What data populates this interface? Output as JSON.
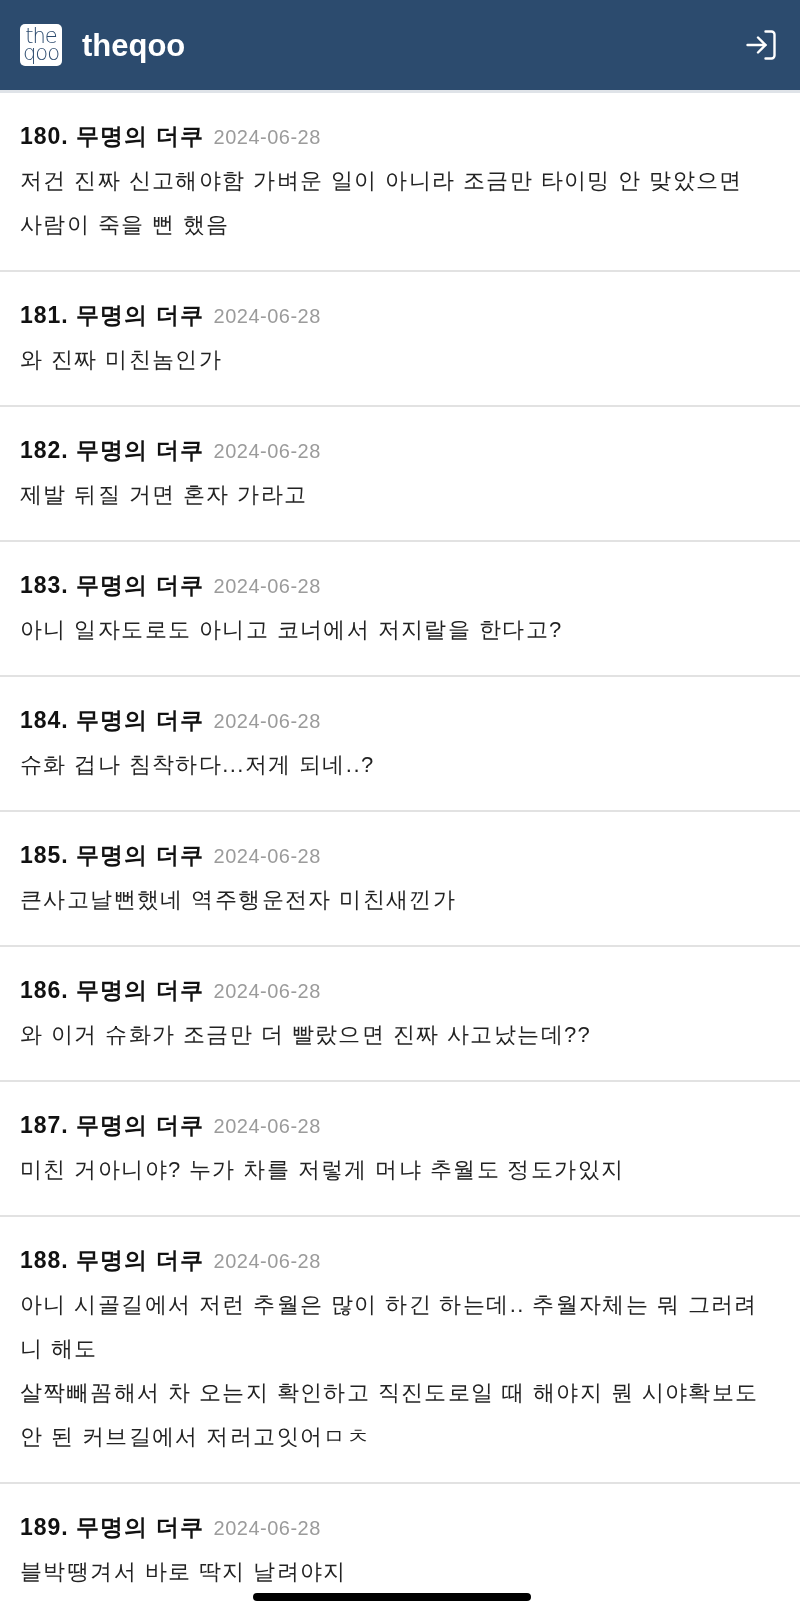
{
  "header": {
    "logo": {
      "lines": [
        "the",
        "qoo"
      ]
    },
    "title": "theqoo"
  },
  "comments": [
    {
      "title": "180. 무명의 더쿠",
      "date": "2024-06-28",
      "body": "저건 진짜 신고해야함 가벼운 일이 아니라 조금만 타이밍 안 맞았으면 사람이 죽을 뻔 했음"
    },
    {
      "title": "181. 무명의 더쿠",
      "date": "2024-06-28",
      "body": "와 진짜 미친놈인가"
    },
    {
      "title": "182. 무명의 더쿠",
      "date": "2024-06-28",
      "body": "제발 뒤질 거면 혼자 가라고"
    },
    {
      "title": "183. 무명의 더쿠",
      "date": "2024-06-28",
      "body": "아니 일자도로도 아니고 코너에서 저지랄을 한다고?"
    },
    {
      "title": "184. 무명의 더쿠",
      "date": "2024-06-28",
      "body": "슈화 겁나 침착하다...저게 되네..?"
    },
    {
      "title": "185. 무명의 더쿠",
      "date": "2024-06-28",
      "body": "큰사고날뻔했네 역주행운전자 미친새낀가"
    },
    {
      "title": "186. 무명의 더쿠",
      "date": "2024-06-28",
      "body": "와 이거 슈화가 조금만 더 빨랐으면 진짜 사고났는데??"
    },
    {
      "title": "187. 무명의 더쿠",
      "date": "2024-06-28",
      "body": "미친 거아니야? 누가 차를 저렇게 머냐 추월도 정도가있지"
    },
    {
      "title": "188. 무명의 더쿠",
      "date": "2024-06-28",
      "body": "아니 시골길에서 저런 추월은 많이 하긴 하는데.. 추월자체는 뭐 그러려니 해도\n살짝빼꼼해서 차 오는지 확인하고 직진도로일 때 해야지 뭔 시야확보도 안 된 커브길에서 저러고잇어ㅁㅊ"
    },
    {
      "title": "189. 무명의 더쿠",
      "date": "2024-06-28",
      "body": "블박땡겨서 바로 딱지 날려야지"
    }
  ]
}
